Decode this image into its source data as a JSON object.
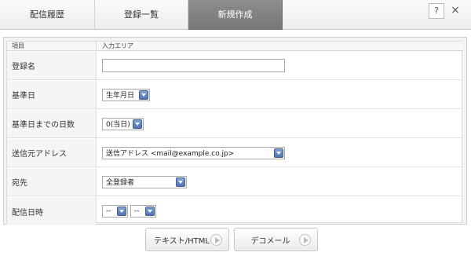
{
  "tabs": [
    {
      "label": "配信履歴"
    },
    {
      "label": "登録一覧"
    },
    {
      "label": "新規作成"
    }
  ],
  "header_buttons": {
    "help": "?",
    "close": "×"
  },
  "table_header": {
    "item": "項目",
    "input_area": "入力エリア"
  },
  "rows": {
    "name": {
      "label": "登録名",
      "value": ""
    },
    "base_date": {
      "label": "基準日",
      "selected": "生年月日"
    },
    "days": {
      "label": "基準日までの日数",
      "selected": "0(当日)"
    },
    "sender": {
      "label": "送信元アドレス",
      "selected": "送信アドレス <mail@example.co.jp>"
    },
    "recipient": {
      "label": "宛先",
      "selected": "全登録者"
    },
    "time": {
      "label": "配信日時",
      "hour": "--",
      "minute": "--"
    }
  },
  "buttons": {
    "text_html": "テキスト/HTML",
    "deco": "デコメール"
  },
  "colors": {
    "active_tab": "#808080",
    "select_arrow": "#5a7fc0"
  }
}
